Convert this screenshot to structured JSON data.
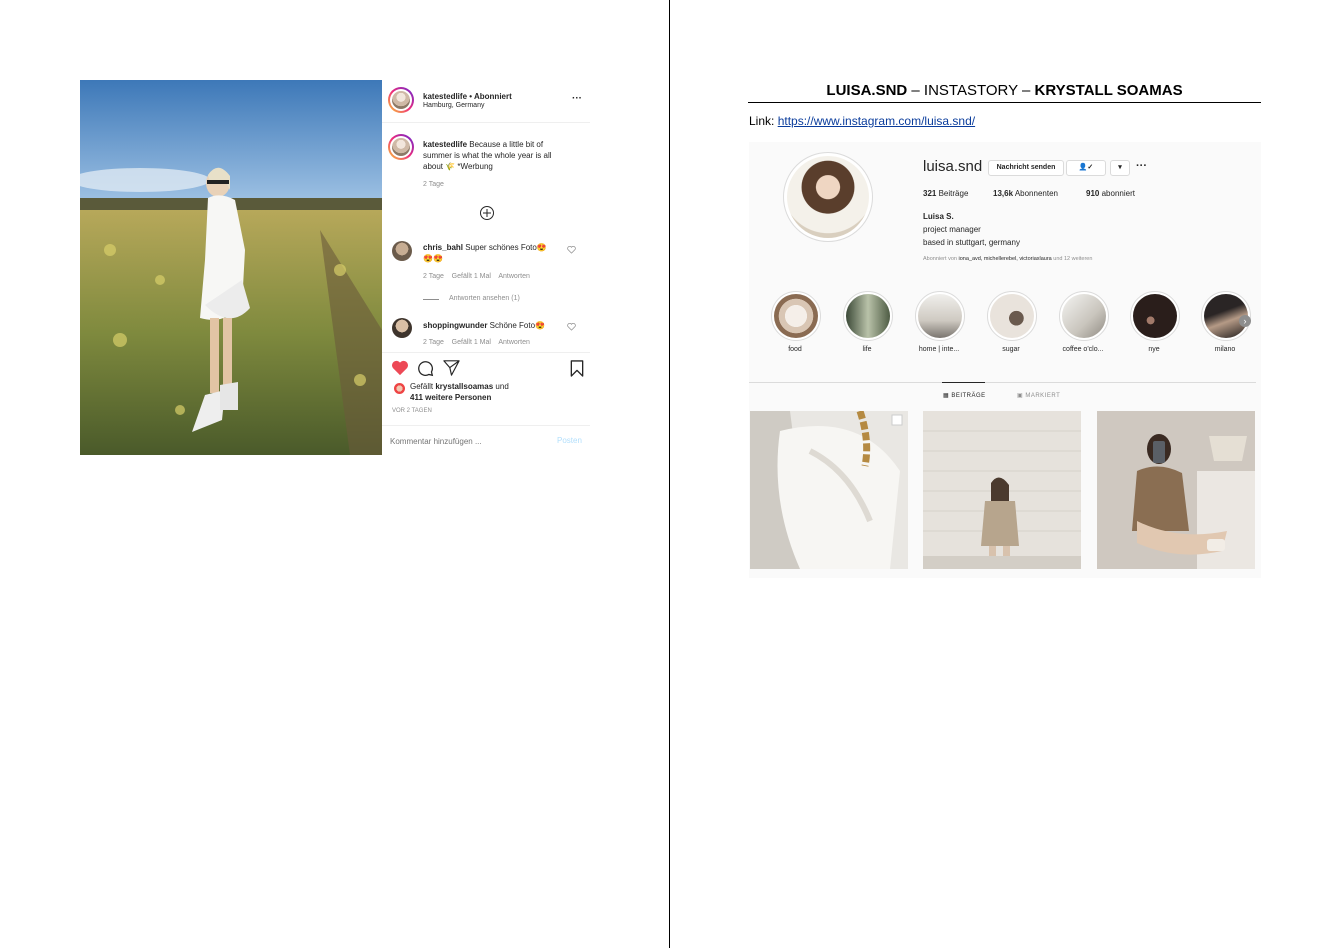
{
  "post": {
    "username": "katestedlife",
    "follow_status": "• Abonniert",
    "location": "Hamburg, Germany",
    "more": "···",
    "caption_user": "katestedlife",
    "caption_text_1": "Because a little bit of",
    "caption_text_2": "summer is what the whole year is all",
    "caption_text_3": "about 🌾 *Werbung",
    "caption_time": "2 Tage",
    "comments": [
      {
        "user": "chris_bahl",
        "text": "Super schönes Foto😍",
        "text2": "😍😍",
        "time": "2 Tage",
        "likes": "Gefällt 1 Mal",
        "reply": "Antworten"
      },
      {
        "user": "shoppingwunder",
        "text": "Schöne Foto😍",
        "time": "2 Tage",
        "likes": "Gefällt 1 Mal",
        "reply": "Antworten"
      }
    ],
    "view_replies": "Antworten ansehen (1)",
    "likes_prefix": "Gefällt",
    "likes_user": "krystallsoamas",
    "likes_and": "und",
    "likes_others": "411 weitere Personen",
    "date": "VOR 2 TAGEN",
    "comment_placeholder": "Kommentar hinzufügen ...",
    "post_button": "Posten"
  },
  "doc": {
    "title_a": "LUISA.SND",
    "title_sep1": " – INSTASTORY – ",
    "title_b": "KRYSTALL SOAMAS",
    "link_label": "Link: ",
    "link_url": "https://www.instagram.com/luisa.snd/"
  },
  "profile": {
    "username": "luisa.snd",
    "message_button": "Nachricht senden",
    "follow_icon": "👤✓",
    "dropdown": "▾",
    "more": "···",
    "posts_count": "321",
    "posts_label": "Beiträge",
    "followers_count": "13,6k",
    "followers_label": "Abonnenten",
    "following_count": "910",
    "following_label": "abonniert",
    "name": "Luisa S.",
    "bio_1": "project manager",
    "bio_2": "based in stuttgart, germany",
    "followed_by_prefix": "Abonniert von",
    "followed_by_names": "iona_avd, michellerebel, victoriaxlaura",
    "followed_by_suffix": "und 12 weiteren",
    "stories": [
      "food",
      "life",
      "home | inte...",
      "sugar",
      "coffee o'clo...",
      "nye",
      "milano"
    ],
    "tab_posts": "BEITRÄGE",
    "tab_tagged": "MARKIERT"
  },
  "colors": {
    "heart": "#ed4956",
    "link": "#0a3c9c",
    "post_button": "#b2dffc"
  }
}
